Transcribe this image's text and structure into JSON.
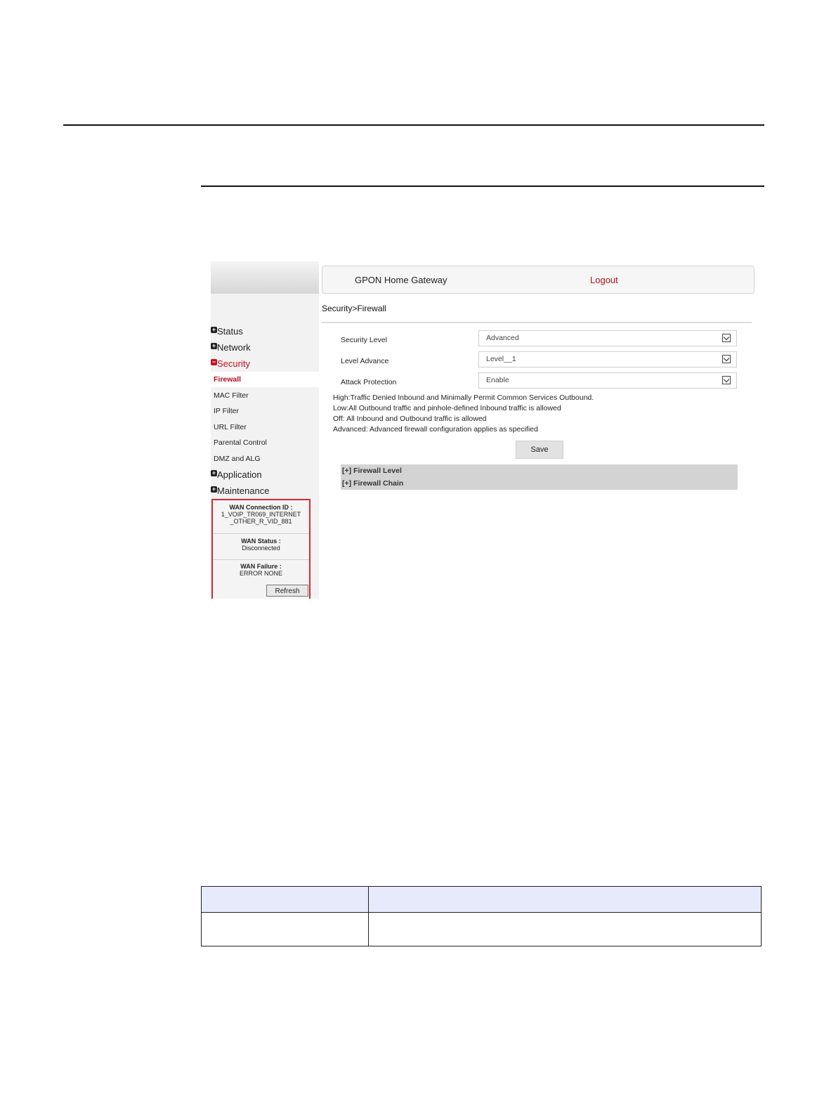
{
  "gateway": {
    "title": "GPON Home Gateway",
    "logout": "Logout",
    "breadcrumb": "Security>Firewall"
  },
  "sidebar": {
    "items": [
      {
        "label": "Status",
        "state": "collapsed"
      },
      {
        "label": "Network",
        "state": "collapsed"
      },
      {
        "label": "Security",
        "state": "expanded"
      },
      {
        "label": "Application",
        "state": "collapsed"
      },
      {
        "label": "Maintenance",
        "state": "collapsed"
      }
    ],
    "security_sub": [
      "Firewall",
      "MAC Filter",
      "IP Filter",
      "URL Filter",
      "Parental Control",
      "DMZ and ALG"
    ],
    "selected_sub": "Firewall"
  },
  "wan": {
    "connection_label": "WAN Connection ID :",
    "connection_line1": "1_VOIP_TR069_INTERNET",
    "connection_line2": "_OTHER_R_VID_881",
    "status_label": "WAN Status :",
    "status_value": "Disconnected",
    "failure_label": "WAN Failure :",
    "failure_value": "ERROR NONE",
    "refresh": "Refresh"
  },
  "form": {
    "security_level_label": "Security Level",
    "security_level_value": "Advanced",
    "level_advance_label": "Level Advance",
    "level_advance_value": "Level__1",
    "attack_protection_label": "Attack Protection",
    "attack_protection_value": "Enable",
    "descriptions": [
      "High:Traffic Denied Inbound and Minimally Permit Common Services Outbound.",
      "Low:All Outbound traffic and pinhole-defined Inbound traffic is allowed",
      "Off: All Inbound and Outbound traffic is allowed",
      "Advanced: Advanced firewall configuration applies as specified"
    ],
    "save": "Save",
    "firewall_level": "[+] Firewall Level",
    "firewall_chain": "[+] Firewall Chain"
  },
  "colors": {
    "accent_red": "#b0101c",
    "table_header": "#e6eafb"
  }
}
